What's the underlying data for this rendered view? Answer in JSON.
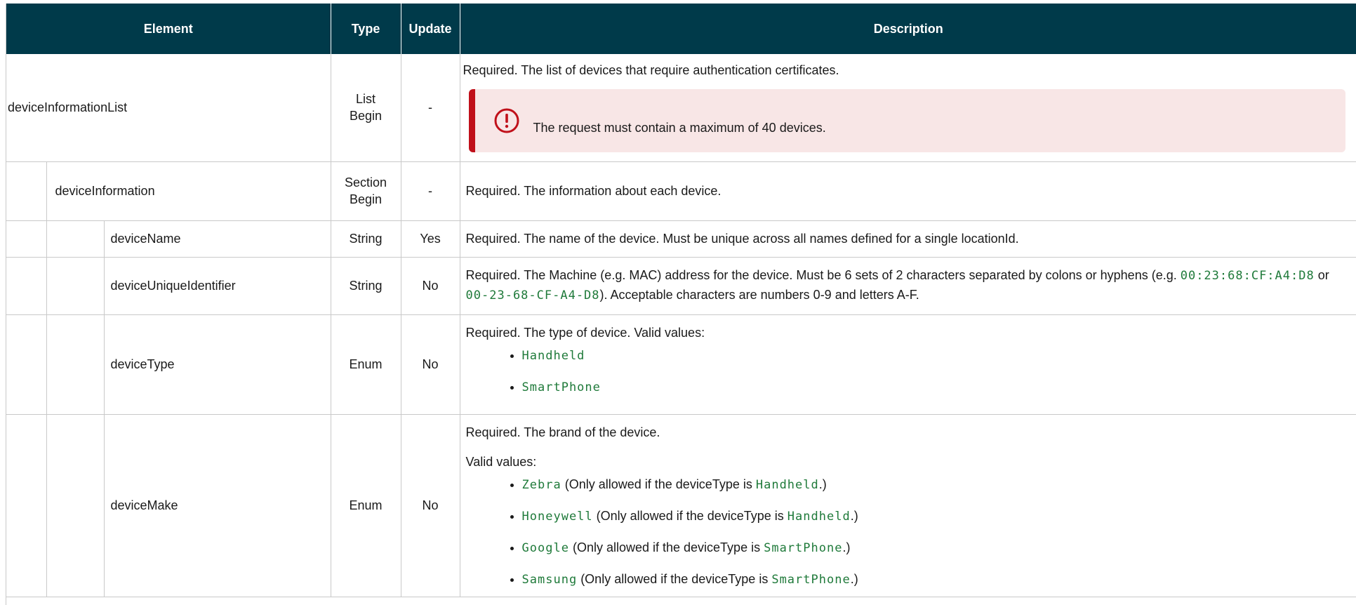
{
  "header": {
    "element": "Element",
    "type": "Type",
    "update": "Update",
    "description": "Description"
  },
  "rows": {
    "r1": {
      "element": "deviceInformationList",
      "type_line1": "List",
      "type_line2": "Begin",
      "update": "-",
      "desc": "Required. The list of devices that require authentication certificates.",
      "note": "The request must contain a maximum of 40 devices.",
      "note_icon": "alert-circle-icon",
      "note_color": "#c0101a"
    },
    "r2": {
      "element": "deviceInformation",
      "type_line1": "Section",
      "type_line2": "Begin",
      "update": "-",
      "desc": "Required. The information about each device."
    },
    "r3": {
      "element": "deviceName",
      "type": "String",
      "update": "Yes",
      "desc": "Required. The name of the device. Must be unique across all names defined for a single locationId."
    },
    "r4": {
      "element": "deviceUniqueIdentifier",
      "type": "String",
      "update": "No",
      "desc_a": "Required. The Machine (e.g. MAC) address for the device. Must be 6 sets of 2 characters separated by colons or hyphens (e.g. ",
      "code1": "00:23:68:CF:A4:D8",
      "desc_b": " or ",
      "code2": "00-23-68-CF-A4-D8",
      "desc_c": "). Acceptable characters are numbers 0-9 and letters A-F."
    },
    "r5": {
      "element": "deviceType",
      "type": "Enum",
      "update": "No",
      "desc": "Required. The type of device. Valid values:",
      "values": [
        "Handheld",
        "SmartPhone"
      ]
    },
    "r6": {
      "element": "deviceMake",
      "type": "Enum",
      "update": "No",
      "desc1": "Required. The brand of the device.",
      "desc2": "Valid values:",
      "items": [
        {
          "code": "Zebra",
          "pre": " (Only allowed if the deviceType is ",
          "type_code": "Handheld",
          "post": ".)"
        },
        {
          "code": "Honeywell",
          "pre": " (Only allowed if the deviceType is ",
          "type_code": "Handheld",
          "post": ".)"
        },
        {
          "code": "Google",
          "pre": " (Only allowed if the deviceType is ",
          "type_code": "SmartPhone",
          "post": ".)"
        },
        {
          "code": "Samsung",
          "pre": " (Only allowed if the deviceType is ",
          "type_code": "SmartPhone",
          "post": ".)"
        }
      ]
    }
  },
  "colors": {
    "header_bg": "#003a4a",
    "code_text": "#1f7a3a",
    "note_bg": "#f8e6e6"
  }
}
